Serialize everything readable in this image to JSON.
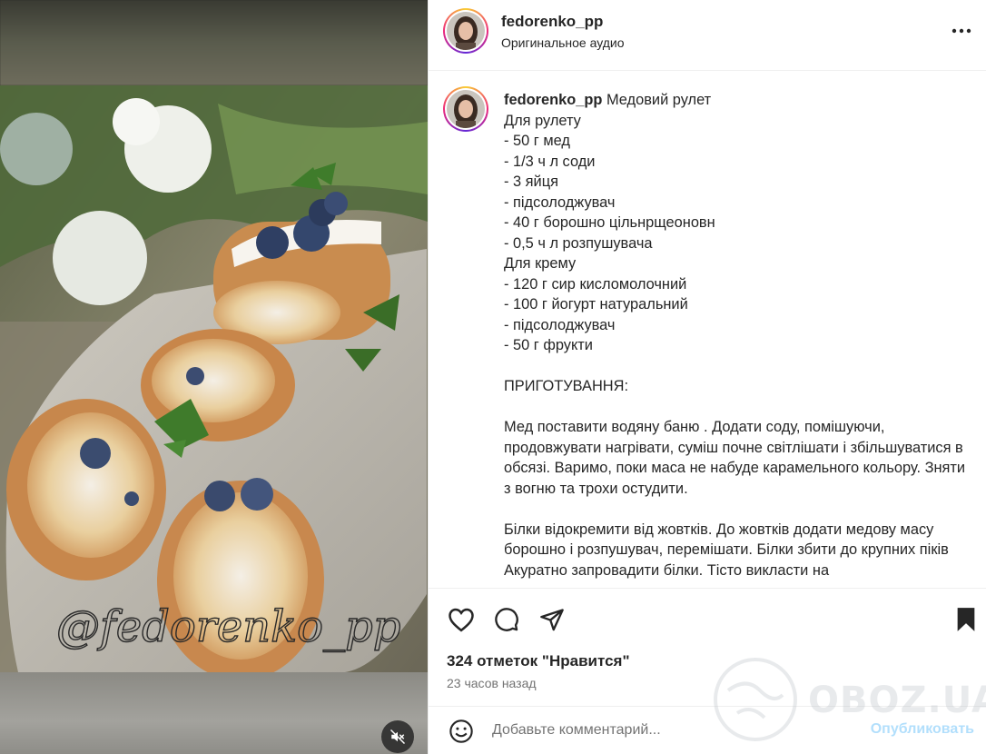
{
  "post": {
    "username": "fedorenko_pp",
    "audio": "Оригинальное аудио",
    "photo_watermark": "@fedorenko_pp"
  },
  "caption": {
    "username": "fedorenko_pp",
    "lines": [
      "Медовий рулет",
      "Для рулету",
      "- 50 г мед",
      "- 1/3 ч л соди",
      "- 3 яйця",
      "- підсолоджувач",
      "- 40 г борошно цільнрщеоновн",
      "- 0,5 ч л розпушувача",
      "Для крему",
      "- 120 г сир кисломолочний",
      "- 100 г йогурт натуральний",
      "- підсолоджувач",
      "- 50 г фрукти",
      "",
      "ПРИГОТУВАННЯ:",
      "",
      "Мед поставити водяну баню . Додати соду, помішуючи, продовжувати нагрівати, суміш почне світлішати і збільшуватися в обсязі. Варимо, поки маса не набуде карамельного кольору. Зняти з вогню та трохи остудити.",
      "",
      "Білки відокремити від жовтків. До жовтків додати медову масу борошно і розпушувач, перемішати. Білки збити до крупних піків Акуратно запровадити білки. Тісто викласти на"
    ]
  },
  "stats": {
    "likes": "324 отметок \"Нравится\"",
    "time_ago": "23 часов назад"
  },
  "comment": {
    "placeholder": "Добавьте комментарий...",
    "post_label": "Опубликовать"
  },
  "overlay": {
    "watermark": "OBOZ.UA"
  },
  "icons": {
    "like": "heart-icon",
    "comment": "comment-icon",
    "share": "send-icon",
    "save": "bookmark-icon",
    "more": "more-icon",
    "mute": "muted-speaker-icon",
    "emoji": "emoji-icon"
  },
  "colors": {
    "text": "#262626",
    "secondary": "#737373",
    "link_disabled": "#b2dffc",
    "divider": "#efefef"
  }
}
